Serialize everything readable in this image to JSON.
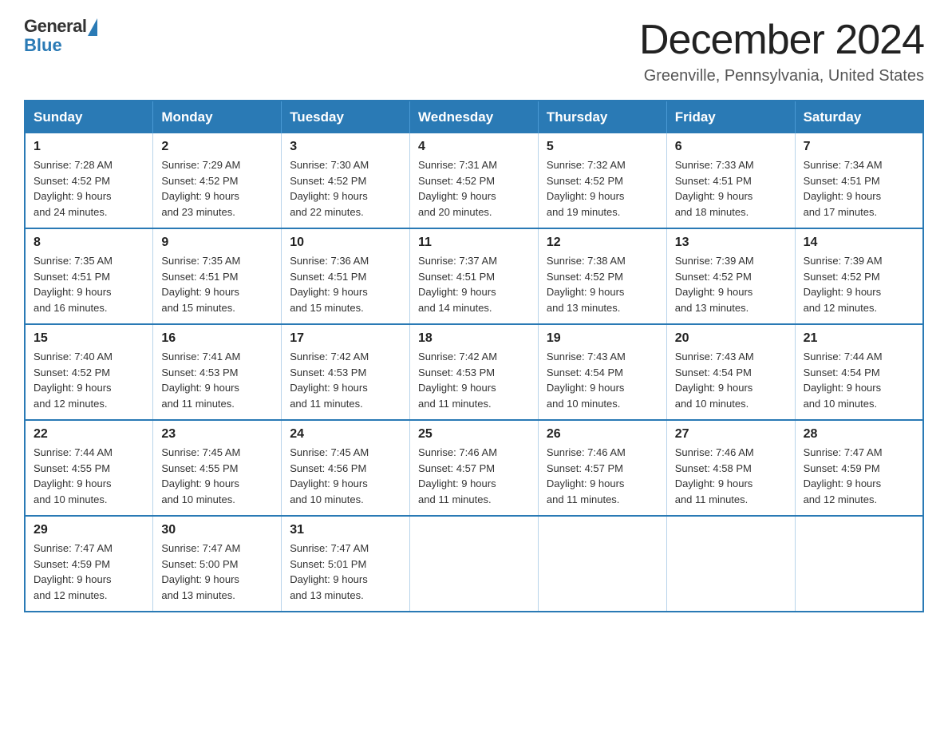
{
  "header": {
    "logo": {
      "general": "General",
      "blue": "Blue"
    },
    "title": "December 2024",
    "location": "Greenville, Pennsylvania, United States"
  },
  "weekdays": [
    "Sunday",
    "Monday",
    "Tuesday",
    "Wednesday",
    "Thursday",
    "Friday",
    "Saturday"
  ],
  "weeks": [
    [
      {
        "day": "1",
        "sunrise": "7:28 AM",
        "sunset": "4:52 PM",
        "daylight": "9 hours and 24 minutes."
      },
      {
        "day": "2",
        "sunrise": "7:29 AM",
        "sunset": "4:52 PM",
        "daylight": "9 hours and 23 minutes."
      },
      {
        "day": "3",
        "sunrise": "7:30 AM",
        "sunset": "4:52 PM",
        "daylight": "9 hours and 22 minutes."
      },
      {
        "day": "4",
        "sunrise": "7:31 AM",
        "sunset": "4:52 PM",
        "daylight": "9 hours and 20 minutes."
      },
      {
        "day": "5",
        "sunrise": "7:32 AM",
        "sunset": "4:52 PM",
        "daylight": "9 hours and 19 minutes."
      },
      {
        "day": "6",
        "sunrise": "7:33 AM",
        "sunset": "4:51 PM",
        "daylight": "9 hours and 18 minutes."
      },
      {
        "day": "7",
        "sunrise": "7:34 AM",
        "sunset": "4:51 PM",
        "daylight": "9 hours and 17 minutes."
      }
    ],
    [
      {
        "day": "8",
        "sunrise": "7:35 AM",
        "sunset": "4:51 PM",
        "daylight": "9 hours and 16 minutes."
      },
      {
        "day": "9",
        "sunrise": "7:35 AM",
        "sunset": "4:51 PM",
        "daylight": "9 hours and 15 minutes."
      },
      {
        "day": "10",
        "sunrise": "7:36 AM",
        "sunset": "4:51 PM",
        "daylight": "9 hours and 15 minutes."
      },
      {
        "day": "11",
        "sunrise": "7:37 AM",
        "sunset": "4:51 PM",
        "daylight": "9 hours and 14 minutes."
      },
      {
        "day": "12",
        "sunrise": "7:38 AM",
        "sunset": "4:52 PM",
        "daylight": "9 hours and 13 minutes."
      },
      {
        "day": "13",
        "sunrise": "7:39 AM",
        "sunset": "4:52 PM",
        "daylight": "9 hours and 13 minutes."
      },
      {
        "day": "14",
        "sunrise": "7:39 AM",
        "sunset": "4:52 PM",
        "daylight": "9 hours and 12 minutes."
      }
    ],
    [
      {
        "day": "15",
        "sunrise": "7:40 AM",
        "sunset": "4:52 PM",
        "daylight": "9 hours and 12 minutes."
      },
      {
        "day": "16",
        "sunrise": "7:41 AM",
        "sunset": "4:53 PM",
        "daylight": "9 hours and 11 minutes."
      },
      {
        "day": "17",
        "sunrise": "7:42 AM",
        "sunset": "4:53 PM",
        "daylight": "9 hours and 11 minutes."
      },
      {
        "day": "18",
        "sunrise": "7:42 AM",
        "sunset": "4:53 PM",
        "daylight": "9 hours and 11 minutes."
      },
      {
        "day": "19",
        "sunrise": "7:43 AM",
        "sunset": "4:54 PM",
        "daylight": "9 hours and 10 minutes."
      },
      {
        "day": "20",
        "sunrise": "7:43 AM",
        "sunset": "4:54 PM",
        "daylight": "9 hours and 10 minutes."
      },
      {
        "day": "21",
        "sunrise": "7:44 AM",
        "sunset": "4:54 PM",
        "daylight": "9 hours and 10 minutes."
      }
    ],
    [
      {
        "day": "22",
        "sunrise": "7:44 AM",
        "sunset": "4:55 PM",
        "daylight": "9 hours and 10 minutes."
      },
      {
        "day": "23",
        "sunrise": "7:45 AM",
        "sunset": "4:55 PM",
        "daylight": "9 hours and 10 minutes."
      },
      {
        "day": "24",
        "sunrise": "7:45 AM",
        "sunset": "4:56 PM",
        "daylight": "9 hours and 10 minutes."
      },
      {
        "day": "25",
        "sunrise": "7:46 AM",
        "sunset": "4:57 PM",
        "daylight": "9 hours and 11 minutes."
      },
      {
        "day": "26",
        "sunrise": "7:46 AM",
        "sunset": "4:57 PM",
        "daylight": "9 hours and 11 minutes."
      },
      {
        "day": "27",
        "sunrise": "7:46 AM",
        "sunset": "4:58 PM",
        "daylight": "9 hours and 11 minutes."
      },
      {
        "day": "28",
        "sunrise": "7:47 AM",
        "sunset": "4:59 PM",
        "daylight": "9 hours and 12 minutes."
      }
    ],
    [
      {
        "day": "29",
        "sunrise": "7:47 AM",
        "sunset": "4:59 PM",
        "daylight": "9 hours and 12 minutes."
      },
      {
        "day": "30",
        "sunrise": "7:47 AM",
        "sunset": "5:00 PM",
        "daylight": "9 hours and 13 minutes."
      },
      {
        "day": "31",
        "sunrise": "7:47 AM",
        "sunset": "5:01 PM",
        "daylight": "9 hours and 13 minutes."
      },
      null,
      null,
      null,
      null
    ]
  ],
  "labels": {
    "sunrise": "Sunrise:",
    "sunset": "Sunset:",
    "daylight": "Daylight:"
  }
}
